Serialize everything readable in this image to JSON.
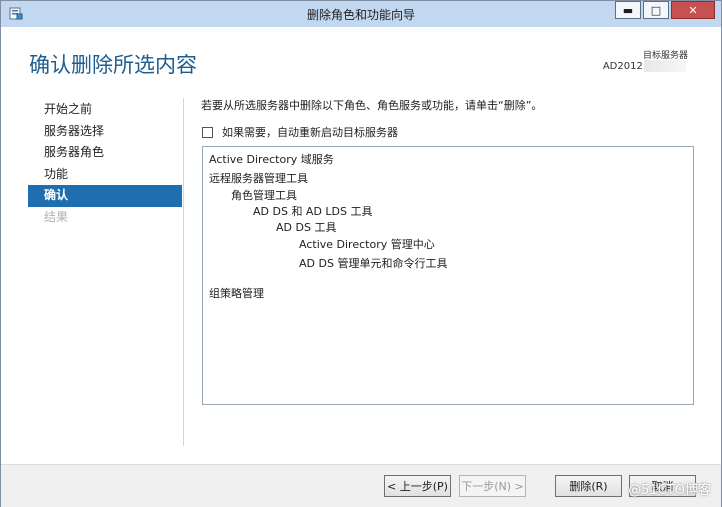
{
  "window": {
    "title": "删除角色和功能向导",
    "controls": {
      "minimize": "▬",
      "maximize": "□",
      "close": "✕"
    }
  },
  "header": {
    "page_title": "确认删除所选内容",
    "target_label": "目标服务器",
    "target_server": "AD2012."
  },
  "nav": {
    "items": [
      {
        "label": "开始之前",
        "state": "normal"
      },
      {
        "label": "服务器选择",
        "state": "normal"
      },
      {
        "label": "服务器角色",
        "state": "normal"
      },
      {
        "label": "功能",
        "state": "normal"
      },
      {
        "label": "确认",
        "state": "active"
      },
      {
        "label": "结果",
        "state": "disabled"
      }
    ]
  },
  "content": {
    "instruction": "若要从所选服务器中删除以下角色、角色服务或功能，请单击“删除”。",
    "restart_checkbox": {
      "label": "如果需要，自动重新启动目标服务器",
      "checked": false
    },
    "list": [
      {
        "text": "Active Directory 域服务",
        "level": 0
      },
      {
        "text": "远程服务器管理工具",
        "level": 0
      },
      {
        "text": "角色管理工具",
        "level": 1
      },
      {
        "text": "AD DS 和 AD LDS 工具",
        "level": 2
      },
      {
        "text": "AD DS 工具",
        "level": 3
      },
      {
        "text": "Active Directory 管理中心",
        "level": 4
      },
      {
        "text": "AD DS 管理单元和命令行工具",
        "level": 4
      },
      {
        "text": "组策略管理",
        "level": 0
      }
    ]
  },
  "footer": {
    "previous": "< 上一步(P)",
    "next": "下一步(N) >",
    "remove": "删除(R)",
    "cancel": "取消"
  },
  "watermark": "@51CTO博客",
  "colors": {
    "accent": "#1f6fb0",
    "title_text": "#1e5d8f",
    "titlebar": "#c2d8f0",
    "close": "#c75050"
  }
}
